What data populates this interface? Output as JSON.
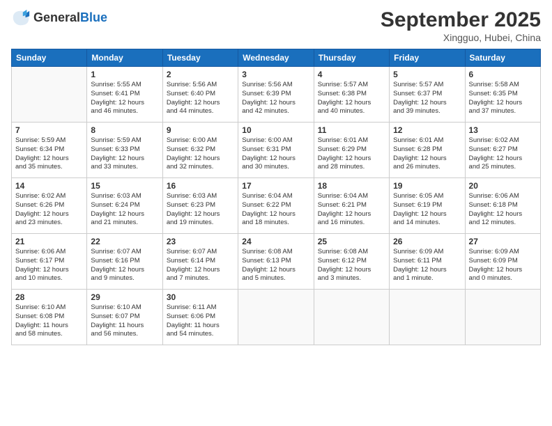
{
  "header": {
    "logo_general": "General",
    "logo_blue": "Blue",
    "month": "September 2025",
    "location": "Xingguo, Hubei, China"
  },
  "days_of_week": [
    "Sunday",
    "Monday",
    "Tuesday",
    "Wednesday",
    "Thursday",
    "Friday",
    "Saturday"
  ],
  "weeks": [
    [
      {
        "day": "",
        "info": ""
      },
      {
        "day": "1",
        "info": "Sunrise: 5:55 AM\nSunset: 6:41 PM\nDaylight: 12 hours\nand 46 minutes."
      },
      {
        "day": "2",
        "info": "Sunrise: 5:56 AM\nSunset: 6:40 PM\nDaylight: 12 hours\nand 44 minutes."
      },
      {
        "day": "3",
        "info": "Sunrise: 5:56 AM\nSunset: 6:39 PM\nDaylight: 12 hours\nand 42 minutes."
      },
      {
        "day": "4",
        "info": "Sunrise: 5:57 AM\nSunset: 6:38 PM\nDaylight: 12 hours\nand 40 minutes."
      },
      {
        "day": "5",
        "info": "Sunrise: 5:57 AM\nSunset: 6:37 PM\nDaylight: 12 hours\nand 39 minutes."
      },
      {
        "day": "6",
        "info": "Sunrise: 5:58 AM\nSunset: 6:35 PM\nDaylight: 12 hours\nand 37 minutes."
      }
    ],
    [
      {
        "day": "7",
        "info": "Sunrise: 5:59 AM\nSunset: 6:34 PM\nDaylight: 12 hours\nand 35 minutes."
      },
      {
        "day": "8",
        "info": "Sunrise: 5:59 AM\nSunset: 6:33 PM\nDaylight: 12 hours\nand 33 minutes."
      },
      {
        "day": "9",
        "info": "Sunrise: 6:00 AM\nSunset: 6:32 PM\nDaylight: 12 hours\nand 32 minutes."
      },
      {
        "day": "10",
        "info": "Sunrise: 6:00 AM\nSunset: 6:31 PM\nDaylight: 12 hours\nand 30 minutes."
      },
      {
        "day": "11",
        "info": "Sunrise: 6:01 AM\nSunset: 6:29 PM\nDaylight: 12 hours\nand 28 minutes."
      },
      {
        "day": "12",
        "info": "Sunrise: 6:01 AM\nSunset: 6:28 PM\nDaylight: 12 hours\nand 26 minutes."
      },
      {
        "day": "13",
        "info": "Sunrise: 6:02 AM\nSunset: 6:27 PM\nDaylight: 12 hours\nand 25 minutes."
      }
    ],
    [
      {
        "day": "14",
        "info": "Sunrise: 6:02 AM\nSunset: 6:26 PM\nDaylight: 12 hours\nand 23 minutes."
      },
      {
        "day": "15",
        "info": "Sunrise: 6:03 AM\nSunset: 6:24 PM\nDaylight: 12 hours\nand 21 minutes."
      },
      {
        "day": "16",
        "info": "Sunrise: 6:03 AM\nSunset: 6:23 PM\nDaylight: 12 hours\nand 19 minutes."
      },
      {
        "day": "17",
        "info": "Sunrise: 6:04 AM\nSunset: 6:22 PM\nDaylight: 12 hours\nand 18 minutes."
      },
      {
        "day": "18",
        "info": "Sunrise: 6:04 AM\nSunset: 6:21 PM\nDaylight: 12 hours\nand 16 minutes."
      },
      {
        "day": "19",
        "info": "Sunrise: 6:05 AM\nSunset: 6:19 PM\nDaylight: 12 hours\nand 14 minutes."
      },
      {
        "day": "20",
        "info": "Sunrise: 6:06 AM\nSunset: 6:18 PM\nDaylight: 12 hours\nand 12 minutes."
      }
    ],
    [
      {
        "day": "21",
        "info": "Sunrise: 6:06 AM\nSunset: 6:17 PM\nDaylight: 12 hours\nand 10 minutes."
      },
      {
        "day": "22",
        "info": "Sunrise: 6:07 AM\nSunset: 6:16 PM\nDaylight: 12 hours\nand 9 minutes."
      },
      {
        "day": "23",
        "info": "Sunrise: 6:07 AM\nSunset: 6:14 PM\nDaylight: 12 hours\nand 7 minutes."
      },
      {
        "day": "24",
        "info": "Sunrise: 6:08 AM\nSunset: 6:13 PM\nDaylight: 12 hours\nand 5 minutes."
      },
      {
        "day": "25",
        "info": "Sunrise: 6:08 AM\nSunset: 6:12 PM\nDaylight: 12 hours\nand 3 minutes."
      },
      {
        "day": "26",
        "info": "Sunrise: 6:09 AM\nSunset: 6:11 PM\nDaylight: 12 hours\nand 1 minute."
      },
      {
        "day": "27",
        "info": "Sunrise: 6:09 AM\nSunset: 6:09 PM\nDaylight: 12 hours\nand 0 minutes."
      }
    ],
    [
      {
        "day": "28",
        "info": "Sunrise: 6:10 AM\nSunset: 6:08 PM\nDaylight: 11 hours\nand 58 minutes."
      },
      {
        "day": "29",
        "info": "Sunrise: 6:10 AM\nSunset: 6:07 PM\nDaylight: 11 hours\nand 56 minutes."
      },
      {
        "day": "30",
        "info": "Sunrise: 6:11 AM\nSunset: 6:06 PM\nDaylight: 11 hours\nand 54 minutes."
      },
      {
        "day": "",
        "info": ""
      },
      {
        "day": "",
        "info": ""
      },
      {
        "day": "",
        "info": ""
      },
      {
        "day": "",
        "info": ""
      }
    ]
  ]
}
